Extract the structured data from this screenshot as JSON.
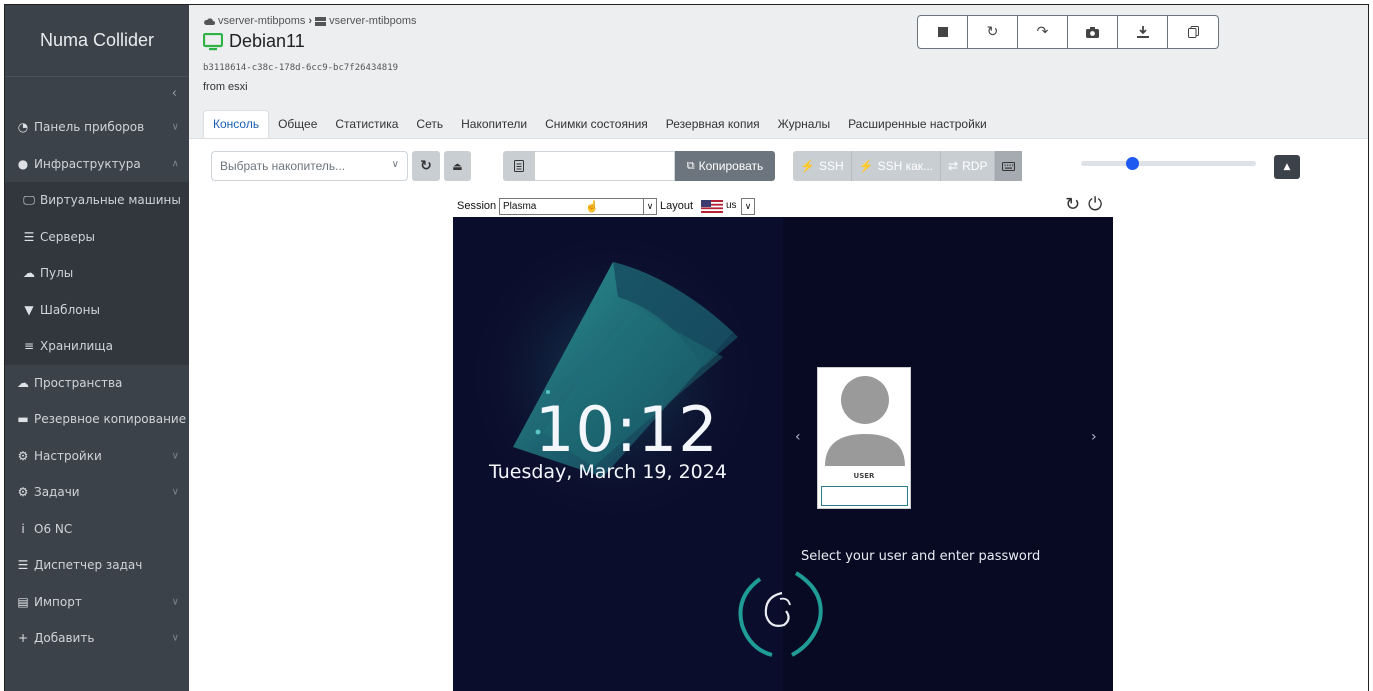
{
  "app": {
    "brand": "Numa Collider"
  },
  "sidebar": {
    "collapse_icon": "chevron-left-icon",
    "items": [
      {
        "label": "Панель приборов",
        "icon": "dashboard-icon",
        "chevron": true
      },
      {
        "label": "Инфраструктура",
        "icon": "globe-icon",
        "chevron": true,
        "expanded": true
      },
      {
        "label": "Виртуальные машины",
        "icon": "monitor-icon",
        "sub": true
      },
      {
        "label": "Серверы",
        "icon": "server-icon",
        "sub": true
      },
      {
        "label": "Пулы",
        "icon": "cloud-icon",
        "sub": true
      },
      {
        "label": "Шаблоны",
        "icon": "pin-icon",
        "sub": true
      },
      {
        "label": "Хранилища",
        "icon": "database-icon",
        "sub": true
      },
      {
        "label": "Пространства",
        "icon": "cloud-icon"
      },
      {
        "label": "Резервное копирование",
        "icon": "archive-icon"
      },
      {
        "label": "Настройки",
        "icon": "gear-icon",
        "chevron": true
      },
      {
        "label": "Задачи",
        "icon": "gears-icon",
        "chevron": true
      },
      {
        "label": "О6 NC",
        "icon": "info-icon"
      },
      {
        "label": "Диспетчер задач",
        "icon": "server-icon"
      },
      {
        "label": "Импорт",
        "icon": "file-import-icon",
        "chevron": true
      },
      {
        "label": "Добавить",
        "icon": "plus-icon",
        "chevron": true
      }
    ]
  },
  "header": {
    "breadcrumb": {
      "pool": "vserver-mtibpoms",
      "host": "vserver-mtibpoms"
    },
    "vm_name": "Debian11",
    "uuid": "b3118614-c38c-178d-6cc9-bc7f26434819",
    "description": "from esxi",
    "toolbar_icons": [
      "stop-icon",
      "restart-icon",
      "forward-icon",
      "snapshot-icon",
      "download-icon",
      "copy-icon"
    ],
    "tabs": [
      "Консоль",
      "Общее",
      "Статистика",
      "Сеть",
      "Накопители",
      "Снимки состояния",
      "Резервная копия",
      "Журналы",
      "Расширенные настройки"
    ],
    "active_tab": 0
  },
  "controls": {
    "storage_placeholder": "Выбрать накопитель...",
    "copy_label": "Копировать",
    "ssh_label": "SSH",
    "ssh_as_label": "SSH как...",
    "rdp_label": "RDP",
    "zoom_level": 0.28
  },
  "vnc": {
    "session_label": "Session",
    "session_value": "Plasma",
    "layout_label": "Layout",
    "layout_value": "us"
  },
  "guest": {
    "time": "10:12",
    "date": "Tuesday, March 19, 2024",
    "user": "USER",
    "hint": "Select your user and enter password"
  }
}
